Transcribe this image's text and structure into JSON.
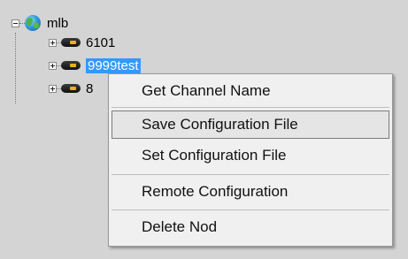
{
  "tree": {
    "root": {
      "label": "mlb",
      "icon": "globe-icon"
    },
    "children": [
      {
        "label": "6101",
        "icon": "device-icon"
      },
      {
        "label": "9999test",
        "icon": "device-icon",
        "selected": true
      },
      {
        "label": "8",
        "icon": "device-icon"
      }
    ]
  },
  "context_menu": {
    "items": [
      {
        "label": "Get Channel Name"
      },
      {
        "label": "Save Configuration File",
        "hovered": true
      },
      {
        "label": "Set Configuration File"
      },
      {
        "label": "Remote Configuration"
      },
      {
        "label": "Delete Nod"
      }
    ]
  },
  "colors": {
    "background": "#d4d4d4",
    "selection": "#3399ff",
    "menu_bg": "#f0f0f0"
  }
}
